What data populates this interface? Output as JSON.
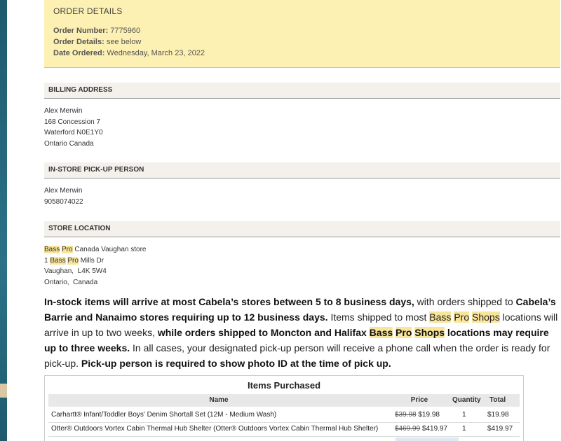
{
  "order": {
    "heading": "ORDER DETAILS",
    "number_label": "Order Number:",
    "number_value": "7775960",
    "details_label": "Order Details:",
    "details_value": "see below",
    "date_label": "Date Ordered:",
    "date_value": "Wednesday, March 23, 2022"
  },
  "billing": {
    "heading": "BILLING ADDRESS",
    "name": "Alex Merwin",
    "street": "168 Concession 7",
    "city": "Waterford N0E1Y0",
    "region": "Ontario Canada"
  },
  "pickup": {
    "heading": "IN-STORE PICK-UP PERSON",
    "name": "Alex Merwin",
    "phone": "9058074022"
  },
  "store": {
    "heading": "STORE LOCATION",
    "hl_bass": "Bass",
    "hl_pro": "Pro",
    "line1_rest": "Canada Vaughan store",
    "line2_pre": "1",
    "line2_rest": "Mills Dr",
    "line3": "Vaughan,  L4K 5W4",
    "line4": "Ontario,  Canada"
  },
  "notice": {
    "p1_bold": "In-stock items will arrive at most Cabela’s stores between 5 to 8 business days,",
    "p2": " with orders shipped to ",
    "p3_bold": "Cabela’s Barrie and Nanaimo stores requiring up to 12 business days.",
    "p4": " Items shipped to most ",
    "hl_bass": "Bass",
    "hl_pro": "Pro",
    "hl_shops": "Shops",
    "p5": " locations will arrive in up to two weeks, ",
    "p6_bold": "while orders shipped to Moncton and Halifax ",
    "p7_bold": " locations may require up to three weeks.",
    "p8": " In all cases, your designated pick-up person will receive a phone call when the order is ready for pick-up. ",
    "p9_bold": "Pick-up person is required to show photo ID at the time of pick up."
  },
  "items": {
    "title": "Items Purchased",
    "headers": {
      "name": "Name",
      "price": "Price",
      "quantity": "Quantity",
      "total": "Total"
    },
    "rows": [
      {
        "name": "Carhartt® Infant/Toddler Boys' Denim Shortall Set (12M - Medium Wash)",
        "old_price": "$39.98",
        "price": "$19.98",
        "quantity": "1",
        "total": "$19.98"
      },
      {
        "name": "Otter® Outdoors Vortex Cabin Thermal Hub Shelter (Otter® Outdoors Vortex Cabin Thermal Hub Shelter)",
        "old_price": "$469.99",
        "price": "$419.97",
        "quantity": "1",
        "total": "$419.97"
      }
    ]
  }
}
